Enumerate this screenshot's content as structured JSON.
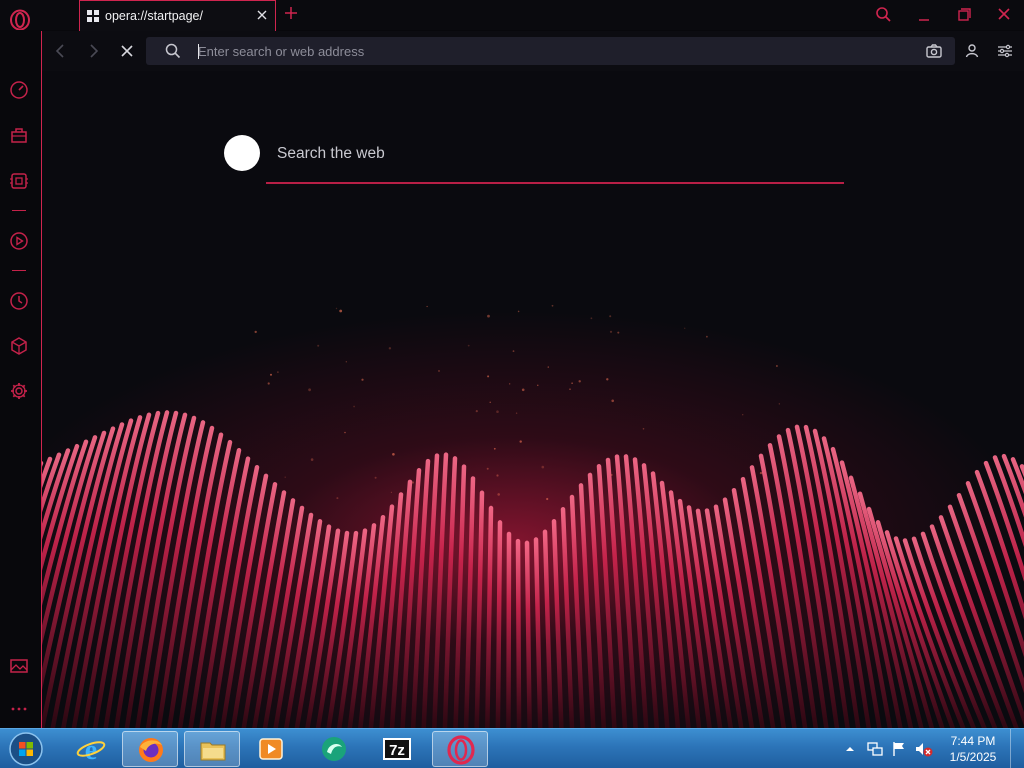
{
  "browser": {
    "tab": {
      "title": "opera://startpage/",
      "favicon": "speed-dial-grid-icon"
    },
    "address_bar": {
      "placeholder": "Enter search or web address",
      "value": ""
    },
    "accent_color": "#d0254f"
  },
  "sidebar": {
    "items": [
      {
        "name": "speed-dial-icon"
      },
      {
        "name": "shopping-bag-icon"
      },
      {
        "name": "ai-assistant-icon"
      },
      {
        "name": "player-icon"
      },
      {
        "name": "history-icon"
      },
      {
        "name": "extensions-cube-icon"
      },
      {
        "name": "settings-gear-icon"
      },
      {
        "name": "wallpaper-icon"
      },
      {
        "name": "more-dots-icon"
      }
    ]
  },
  "startpage": {
    "search_placeholder": "Search the web"
  },
  "taskbar": {
    "apps": [
      {
        "name": "internet-explorer-icon"
      },
      {
        "name": "firefox-icon"
      },
      {
        "name": "file-explorer-icon"
      },
      {
        "name": "media-player-icon"
      },
      {
        "name": "sharing-app-icon"
      },
      {
        "name": "7zip-icon",
        "label": "7z"
      },
      {
        "name": "opera-icon"
      }
    ],
    "clock": {
      "time": "7:44 PM",
      "date": "1/5/2025"
    }
  }
}
